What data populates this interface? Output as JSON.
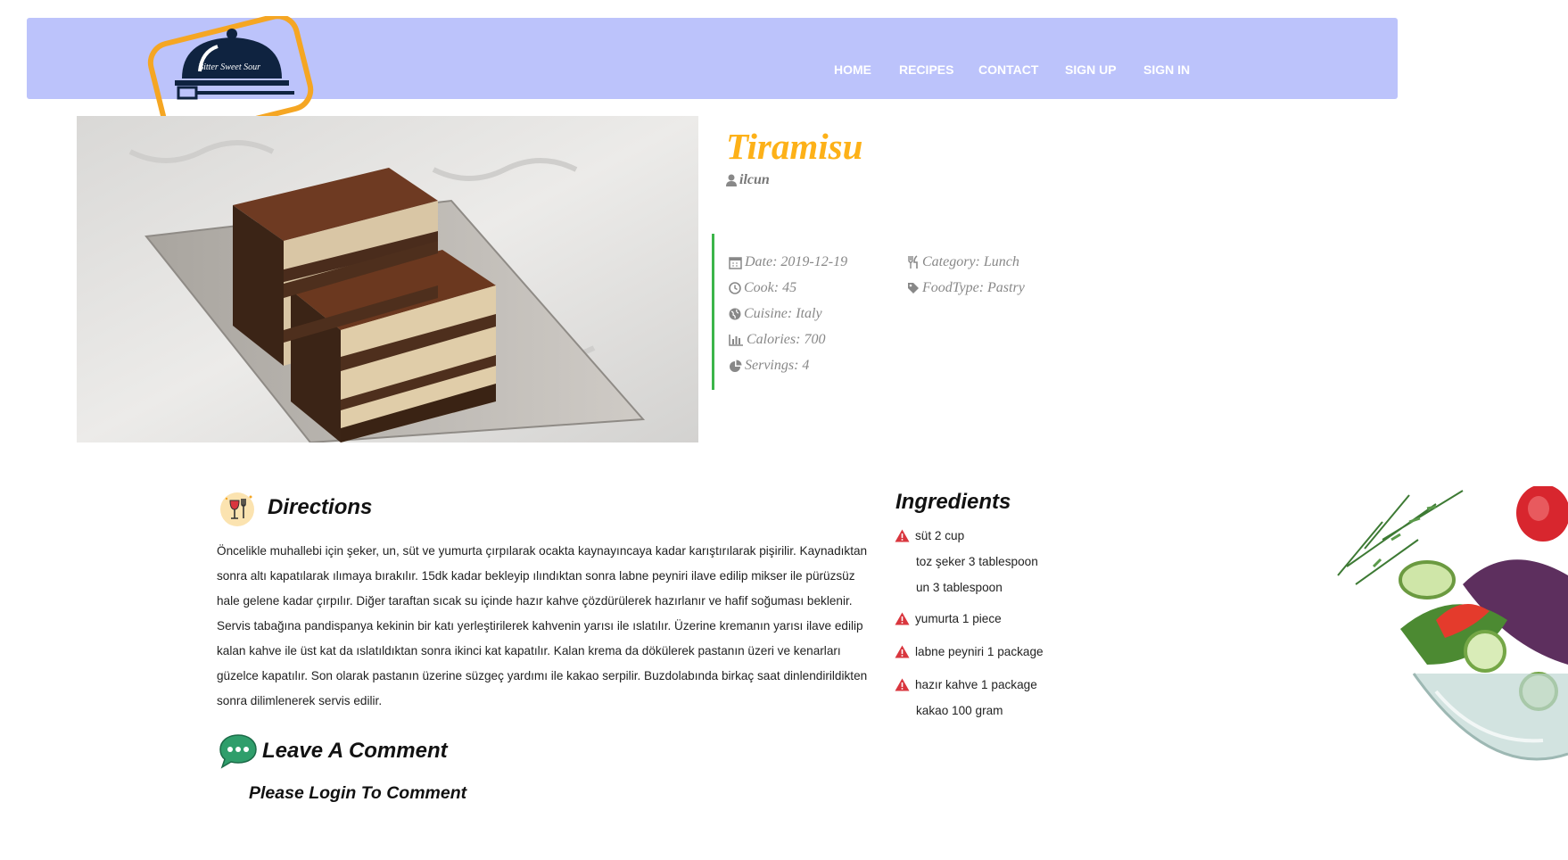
{
  "brand": {
    "logo_text": "Bitter Sweet Sour"
  },
  "nav": {
    "items": [
      {
        "label": "HOME"
      },
      {
        "label": "RECIPES"
      },
      {
        "label": "CONTACT"
      },
      {
        "label": "SIGN UP"
      },
      {
        "label": "SIGN IN"
      }
    ]
  },
  "recipe": {
    "title": "Tiramisu",
    "author": "ilcun",
    "meta": {
      "date": "Date: 2019-12-19",
      "cook": "Cook: 45",
      "cuisine": "Cuisine: Italy",
      "calories": "Calories: 700",
      "servings": "Servings: 4",
      "category": "Category: Lunch",
      "foodtype": "FoodType: Pastry"
    }
  },
  "directions": {
    "heading": "Directions",
    "text": "Öncelikle muhallebi için şeker, un, süt ve yumurta çırpılarak ocakta kaynayıncaya kadar karıştırılarak pişirilir. Kaynadıktan sonra altı kapatılarak ılımaya bırakılır. 15dk kadar bekleyip ılındıktan sonra labne peyniri ilave edilip mikser ile pürüzsüz hale gelene kadar çırpılır. Diğer taraftan sıcak su içinde hazır kahve çözdürülerek hazırlanır ve hafif soğuması beklenir. Servis tabağına pandispanya kekinin bir katı yerleştirilerek kahvenin yarısı ile ıslatılır. Üzerine kremanın yarısı ilave edilip kalan kahve ile üst kat da ıslatıldıktan sonra ikinci kat kapatılır. Kalan krema da dökülerek pastanın üzeri ve kenarları güzelce kapatılır. Son olarak pastanın üzerine süzgeç yardımı ile kakao serpilir. Buzdolabında birkaç saat dinlendirildikten sonra dilimlenerek servis edilir."
  },
  "ingredients": {
    "heading": "Ingredients",
    "items": [
      {
        "label": "süt 2 cup"
      },
      {
        "label": "toz şeker 3 tablespoon"
      },
      {
        "label": "un 3 tablespoon"
      },
      {
        "label": "yumurta 1 piece"
      },
      {
        "label": "labne peyniri 1 package"
      },
      {
        "label": "hazır kahve 1 package"
      },
      {
        "label": "kakao 100 gram"
      }
    ]
  },
  "comments": {
    "heading": "Leave A Comment",
    "login_message": "Please Login To Comment"
  },
  "colors": {
    "navbar": "#bcc3fb",
    "title": "#fdb118",
    "accent_border": "#3cb54a",
    "warning_icon": "#d9363e",
    "logo_border": "#f5a623"
  }
}
